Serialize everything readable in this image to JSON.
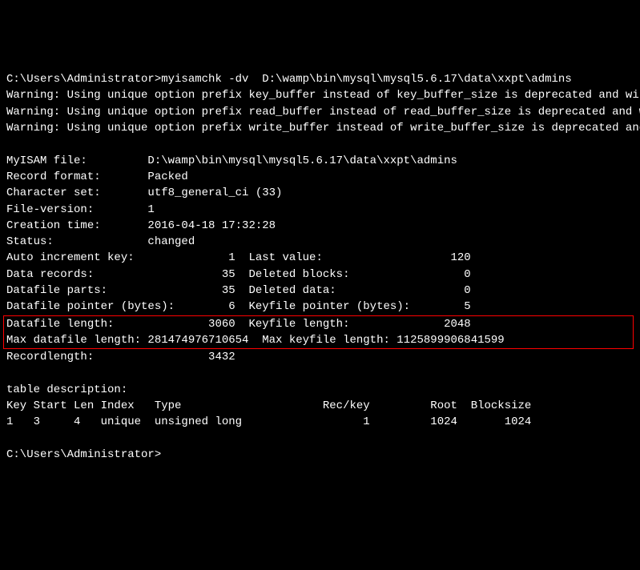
{
  "prompt_line": "C:\\Users\\Administrator>myisamchk -dv  D:\\wamp\\bin\\mysql\\mysql5.6.17\\data\\xxpt\\admins",
  "warnings": [
    "Warning: Using unique option prefix key_buffer instead of key_buffer_size is deprecated and will be removed in a future release. Please use the full name instead.",
    "Warning: Using unique option prefix read_buffer instead of read_buffer_size is deprecated and will be removed in a future release. Please use the full name instead.",
    "Warning: Using unique option prefix write_buffer instead of write_buffer_size is deprecated and will be removed in a future release. Please use the full name instead."
  ],
  "info": {
    "myisam_file_line": "MyISAM file:         D:\\wamp\\bin\\mysql\\mysql5.6.17\\data\\xxpt\\admins",
    "record_format_line": "Record format:       Packed",
    "charset_line": "Character set:       utf8_general_ci (33)",
    "file_version_line": "File-version:        1",
    "creation_time_line": "Creation time:       2016-04-18 17:32:28",
    "status_line": "Status:              changed",
    "auto_inc_line": "Auto increment key:              1  Last value:                   120",
    "data_records_line": "Data records:                   35  Deleted blocks:                 0",
    "datafile_parts_line": "Datafile parts:                 35  Deleted data:                   0",
    "datafile_ptr_line": "Datafile pointer (bytes):        6  Keyfile pointer (bytes):        5",
    "datafile_len_line": "Datafile length:              3060  Keyfile length:              2048",
    "max_datafile_line": "Max datafile length: 281474976710654  Max keyfile length: 1125899906841599",
    "record_length_line": "Recordlength:                 3432"
  },
  "table_desc_header": "table description:",
  "table_cols": "Key Start Len Index   Type                     Rec/key         Root  Blocksize",
  "table_row": "1   3     4   unique  unsigned long                  1         1024       1024",
  "end_prompt": "C:\\Users\\Administrator>"
}
